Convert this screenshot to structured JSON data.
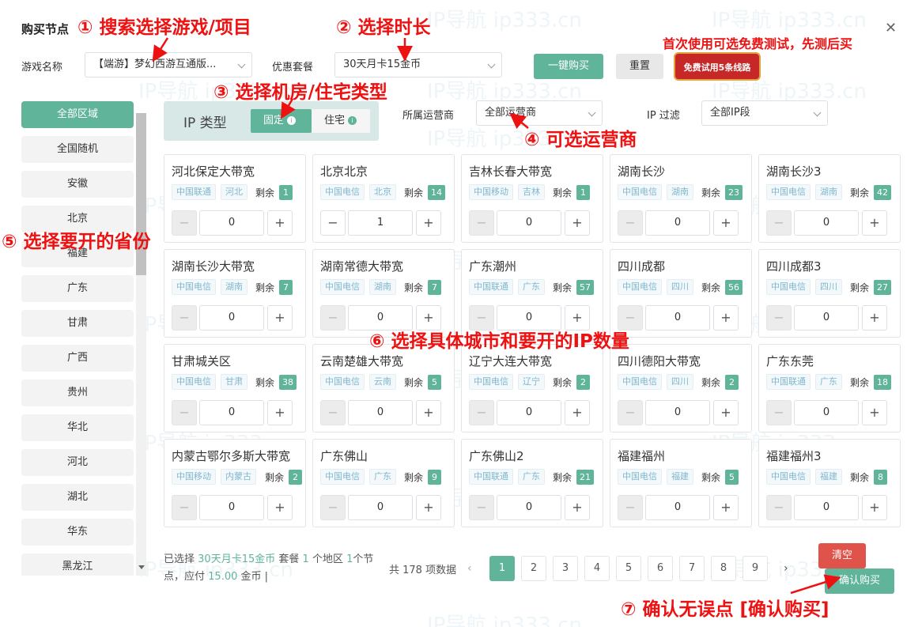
{
  "dialog": {
    "title": "购买节点"
  },
  "form": {
    "game_label": "游戏名称",
    "game_value": "【端游】梦幻西游互通版...",
    "plan_label": "优惠套餐",
    "plan_value": "30天月卡15金币",
    "buy_label": "一键购买",
    "reset_label": "重置",
    "trial_label": "免费试用5条线路"
  },
  "iptype": {
    "label": "IP 类型",
    "fixed": "固定",
    "home": "住宅"
  },
  "filters": {
    "isp_label": "所属运营商",
    "isp_value": "全部运营商",
    "ipfilter_label": "IP 过滤",
    "ipfilter_value": "全部IP段"
  },
  "sidebar": {
    "items": [
      "全部区域",
      "全国随机",
      "安徽",
      "北京",
      "福建",
      "广东",
      "甘肃",
      "广西",
      "贵州",
      "华北",
      "河北",
      "湖北",
      "华东",
      "黑龙江"
    ]
  },
  "remain_label": "剩余",
  "cards": [
    {
      "title": "河北保定大带宽",
      "isp": "中国联通",
      "region": "河北",
      "remain": "1",
      "qty": "0"
    },
    {
      "title": "北京北京",
      "isp": "中国电信",
      "region": "北京",
      "remain": "14",
      "qty": "1"
    },
    {
      "title": "吉林长春大带宽",
      "isp": "中国移动",
      "region": "吉林",
      "remain": "1",
      "qty": "0"
    },
    {
      "title": "湖南长沙",
      "isp": "中国电信",
      "region": "湖南",
      "remain": "23",
      "qty": "0"
    },
    {
      "title": "湖南长沙3",
      "isp": "中国电信",
      "region": "湖南",
      "remain": "42",
      "qty": "0"
    },
    {
      "title": "湖南长沙大带宽",
      "isp": "中国电信",
      "region": "湖南",
      "remain": "7",
      "qty": "0"
    },
    {
      "title": "湖南常德大带宽",
      "isp": "中国电信",
      "region": "湖南",
      "remain": "7",
      "qty": "0"
    },
    {
      "title": "广东潮州",
      "isp": "中国联通",
      "region": "广东",
      "remain": "57",
      "qty": "0"
    },
    {
      "title": "四川成都",
      "isp": "中国电信",
      "region": "四川",
      "remain": "56",
      "qty": "0"
    },
    {
      "title": "四川成都3",
      "isp": "中国电信",
      "region": "四川",
      "remain": "27",
      "qty": "0"
    },
    {
      "title": "甘肃城关区",
      "isp": "中国电信",
      "region": "甘肃",
      "remain": "38",
      "qty": "0"
    },
    {
      "title": "云南楚雄大带宽",
      "isp": "中国电信",
      "region": "云南",
      "remain": "5",
      "qty": "0"
    },
    {
      "title": "辽宁大连大带宽",
      "isp": "中国电信",
      "region": "辽宁",
      "remain": "2",
      "qty": "0"
    },
    {
      "title": "四川德阳大带宽",
      "isp": "中国电信",
      "region": "四川",
      "remain": "2",
      "qty": "0"
    },
    {
      "title": "广东东莞",
      "isp": "中国联通",
      "region": "广东",
      "remain": "18",
      "qty": "0"
    },
    {
      "title": "内蒙古鄂尔多斯大带宽",
      "isp": "中国移动",
      "region": "内蒙古",
      "remain": "2",
      "qty": "0"
    },
    {
      "title": "广东佛山",
      "isp": "中国电信",
      "region": "广东",
      "remain": "9",
      "qty": "0"
    },
    {
      "title": "广东佛山2",
      "isp": "中国联通",
      "region": "广东",
      "remain": "21",
      "qty": "0"
    },
    {
      "title": "福建福州",
      "isp": "中国电信",
      "region": "福建",
      "remain": "5",
      "qty": "0"
    },
    {
      "title": "福建福州3",
      "isp": "中国电信",
      "region": "福建",
      "remain": "8",
      "qty": "0"
    }
  ],
  "summary": {
    "p1": "已选择",
    "plan": "30天月卡15金币",
    "p2": "套餐",
    "regions": "1",
    "p3": "个地区",
    "nodes": "1",
    "p4": "个节点，应付",
    "amount": "15.00",
    "p5": "金币",
    "p6": "|"
  },
  "pagination": {
    "total": "共 178 项数据",
    "pages": [
      "1",
      "2",
      "3",
      "4",
      "5",
      "6",
      "7",
      "8",
      "9"
    ],
    "prev": "‹",
    "next": "›"
  },
  "actions": {
    "clear": "清空",
    "confirm": "确认购买"
  },
  "annotations": {
    "a1": "① 搜索选择游戏/项目",
    "a2": "② 选择时长",
    "a3": "③ 选择机房/住宅类型",
    "a4": "④ 可选运营商",
    "a5": "⑤ 选择要开的省份",
    "a6": "⑥ 选择具体城市和要开的IP数量",
    "a7": "⑦ 确认无误点 [确认购买]",
    "trial_note": "首次使用可选免费测试，先测后买"
  },
  "watermark_text": "IP导航 ip333.cn",
  "colors": {
    "accent": "#5fb49a",
    "danger": "#e0534a",
    "annotation": "#ee1111",
    "tag_text": "#7fb7d0"
  }
}
